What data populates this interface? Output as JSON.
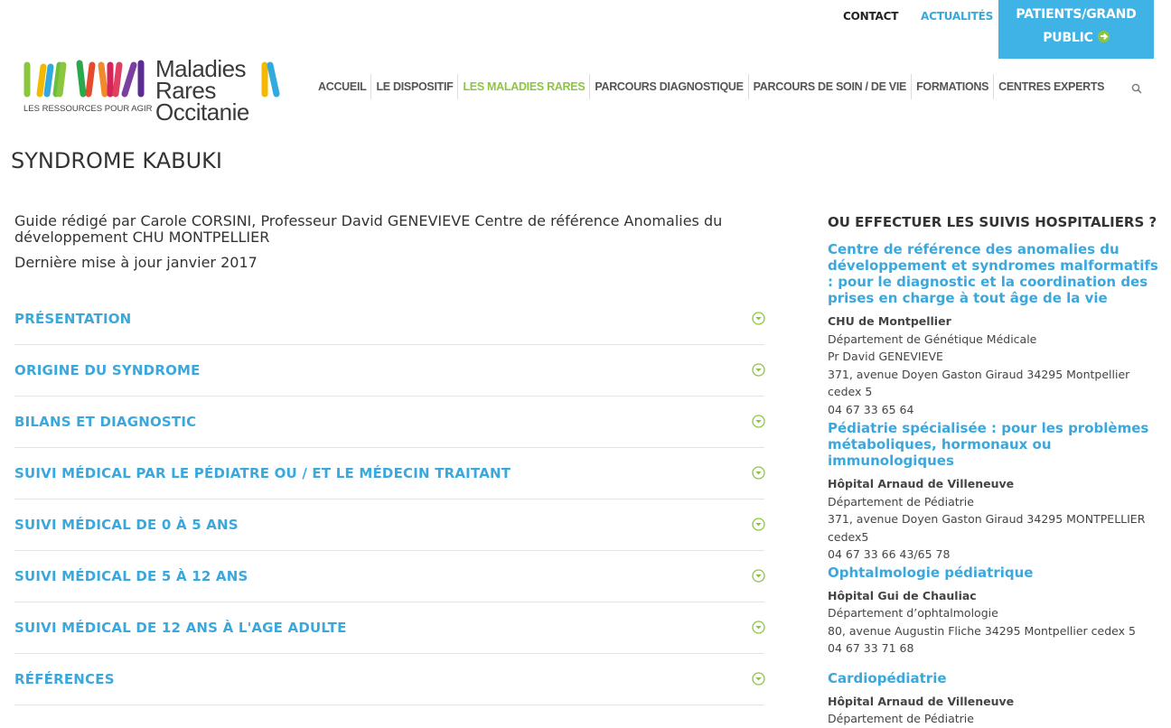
{
  "top_links": {
    "contact": "CONTACT",
    "actualites": "ACTUALITÉS",
    "patients_line1": "PATIENTS/GRAND",
    "patients_line2": "PUBLIC"
  },
  "logo": {
    "title_line1": "Maladies",
    "title_line2": "Rares",
    "title_line3": "Occitanie",
    "tagline": "LES RESSOURCES POUR AGIR"
  },
  "nav": [
    {
      "label": "ACCUEIL"
    },
    {
      "label": "LE DISPOSITIF"
    },
    {
      "label": "LES MALADIES RARES"
    },
    {
      "label": "PARCOURS DIAGNOSTIQUE"
    },
    {
      "label": "PARCOURS DE SOIN / DE VIE"
    },
    {
      "label": "FORMATIONS"
    },
    {
      "label": "CENTRES EXPERTS"
    }
  ],
  "page_title": "SYNDROME KABUKI",
  "intro": {
    "author": "Guide rédigé par Carole CORSINI, Professeur David GENEVIEVE  Centre de référence Anomalies du développement CHU MONTPELLIER",
    "date": "Dernière mise à jour janvier 2017"
  },
  "accordion": [
    {
      "label": "PRÉSENTATION"
    },
    {
      "label": "ORIGINE DU SYNDROME"
    },
    {
      "label": "BILANS ET DIAGNOSTIC"
    },
    {
      "label": "SUIVI MÉDICAL PAR LE PÉDIATRE OU / ET LE MÉDECIN TRAITANT"
    },
    {
      "label": "SUIVI MÉDICAL DE 0 À 5 ANS"
    },
    {
      "label": "SUIVI MÉDICAL DE 5 À 12 ANS"
    },
    {
      "label": "SUIVI MÉDICAL DE 12 ANS À L'AGE ADULTE"
    },
    {
      "label": "RÉFÉRENCES"
    }
  ],
  "sidebar": {
    "heading": "OU EFFECTUER LES SUIVIS HOSPITALIERS ?",
    "blocks": [
      {
        "title": "Centre de référence des anomalies du développement et syndromes malformatifs : pour le diagnostic et la coordination des prises en charge à tout âge de la vie",
        "hospital": "CHU de Montpellier",
        "department": "Département de Génétique Médicale",
        "doctor": "Pr David GENEVIEVE",
        "address": "371, avenue Doyen Gaston Giraud 34295 Montpellier cedex 5",
        "phone": "04 67 33 65 64"
      },
      {
        "title": "Pédiatrie spécialisée : pour les problèmes métaboliques, hormonaux ou immunologiques",
        "hospital": "Hôpital Arnaud de Villeneuve",
        "department": "Département de Pédiatrie",
        "address": "371, avenue Doyen Gaston Giraud 34295 MONTPELLIER cedex5",
        "phone": "04 67 33 66 43/65 78"
      },
      {
        "title": "Ophtalmologie pédiatrique",
        "hospital": "Hôpital Gui de Chauliac",
        "department": "Département d’ophtalmologie",
        "address": "80, avenue Augustin Fliche 34295 Montpellier cedex 5",
        "phone": "04 67 33 71 68"
      },
      {
        "title": "Cardiopédiatrie",
        "hospital": "Hôpital Arnaud de Villeneuve",
        "department": "Département de Pédiatrie"
      }
    ]
  },
  "colors": {
    "accent_blue": "#3aa8dd",
    "accent_green": "#8cc63f",
    "patients_bg": "#3fb3e5"
  }
}
